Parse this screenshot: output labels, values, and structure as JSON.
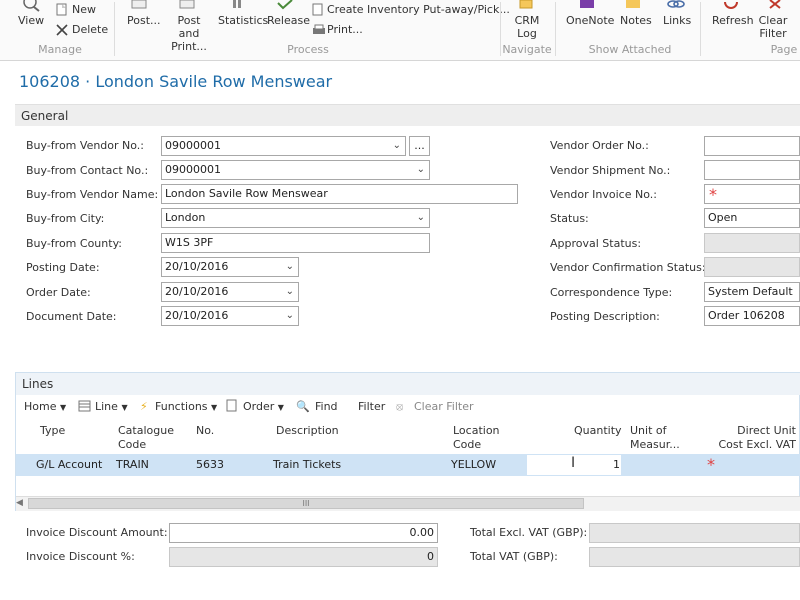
{
  "ribbon": {
    "view": "View",
    "new": "New",
    "delete": "Delete",
    "group_manage": "Manage",
    "post": "Post...",
    "post_and_print": "Post and Print...",
    "statistics": "Statistics",
    "release": "Release",
    "create_inventory": "Create Inventory Put-away/Pick...",
    "print": "Print...",
    "group_process": "Process",
    "crm_log": "CRM Log",
    "group_navigate": "Navigate",
    "onenote": "OneNote",
    "notes": "Notes",
    "links": "Links",
    "group_show_attached": "Show Attached",
    "refresh": "Refresh",
    "clear_filter": "Clear Filter",
    "group_page": "Page"
  },
  "page_title": "106208 · London Savile Row Menswear",
  "general": {
    "header": "General",
    "left": [
      {
        "label": "Buy-from Vendor No.:",
        "value": "09000001"
      },
      {
        "label": "Buy-from Contact No.:",
        "value": "09000001"
      },
      {
        "label": "Buy-from Vendor Name:",
        "value": "London Savile Row Menswear"
      },
      {
        "label": "Buy-from City:",
        "value": "London"
      },
      {
        "label": "Buy-from County:",
        "value": "W1S 3PF"
      },
      {
        "label": "Posting Date:",
        "value": "20/10/2016"
      },
      {
        "label": "Order Date:",
        "value": "20/10/2016"
      },
      {
        "label": "Document Date:",
        "value": "20/10/2016"
      }
    ],
    "right": [
      {
        "label": "Vendor Order No.:",
        "value": ""
      },
      {
        "label": "Vendor Shipment No.:",
        "value": ""
      },
      {
        "label": "Vendor Invoice No.:",
        "value": ""
      },
      {
        "label": "Status:",
        "value": "Open"
      },
      {
        "label": "Approval Status:",
        "value": ""
      },
      {
        "label": "Vendor Confirmation Status:",
        "value": ""
      },
      {
        "label": "Correspondence Type:",
        "value": "System Default"
      },
      {
        "label": "Posting Description:",
        "value": "Order 106208"
      }
    ],
    "ellipsis": "..."
  },
  "lines": {
    "header": "Lines",
    "toolbar": {
      "home": "Home",
      "line": "Line",
      "functions": "Functions",
      "order": "Order",
      "find": "Find",
      "filter": "Filter",
      "clear_filter": "Clear Filter"
    },
    "columns": {
      "type": "Type",
      "catalogue": "Catalogue Code",
      "no": "No.",
      "description": "Description",
      "location": "Location Code",
      "quantity": "Quantity",
      "unit": "Unit of Measur...",
      "direct_cost": "Direct Unit Cost Excl. VAT"
    },
    "row": {
      "type": "G/L Account",
      "catalogue": "TRAIN",
      "no": "5633",
      "description": "Train Tickets",
      "location": "YELLOW",
      "quantity": "1"
    },
    "scroll_grip": "III"
  },
  "totals": {
    "invoice_discount_amount_label": "Invoice Discount Amount:",
    "invoice_discount_amount": "0.00",
    "invoice_discount_pct_label": "Invoice Discount %:",
    "invoice_discount_pct": "0",
    "total_excl_vat_label": "Total Excl. VAT (GBP):",
    "total_vat_label": "Total VAT (GBP):"
  },
  "colors": {
    "title": "#1f6ca8",
    "selected_row": "#cfe3f5",
    "required": "#e04040"
  }
}
